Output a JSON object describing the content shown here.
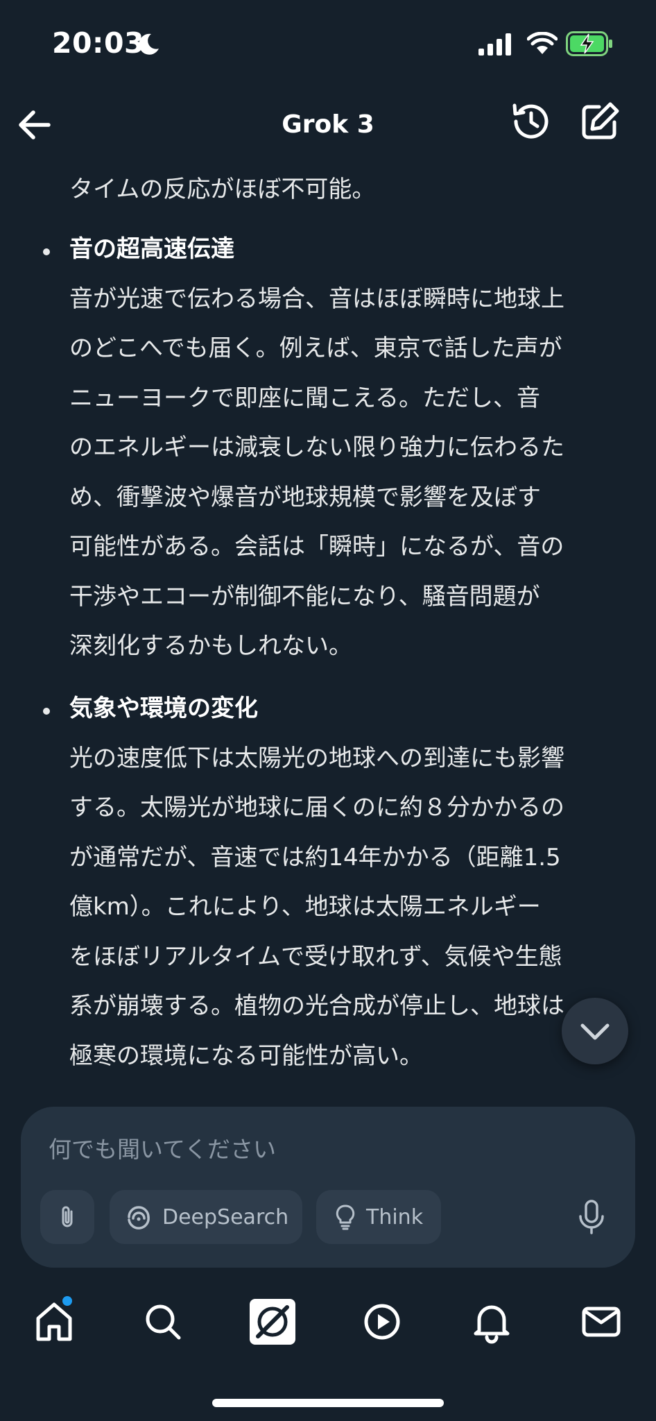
{
  "status": {
    "time": "20:03"
  },
  "header": {
    "title": "Grok 3"
  },
  "chat": {
    "intro_line": "タイムの反応がほぼ不可能。",
    "sections": [
      {
        "heading": "音の超高速伝達",
        "lines": [
          "音が光速で伝わる場合、音はほぼ瞬時に地球上",
          "のどこへでも届く。例えば、東京で話した声が",
          "ニューヨークで即座に聞こえる。ただし、音",
          "のエネルギーは減衰しない限り強力に伝わるた",
          "め、衝撃波や爆音が地球規模で影響を及ぼす",
          "可能性がある。会話は「瞬時」になるが、音の",
          "干渉やエコーが制御不能になり、騒音問題が",
          "深刻化するかもしれない。"
        ]
      },
      {
        "heading": "気象や環境の変化",
        "lines": [
          "光の速度低下は太陽光の地球への到達にも影響",
          "する。太陽光が地球に届くのに約８分かかるの",
          "が通常だが、音速では約14年かかる（距離1.5",
          "億km）。これにより、地球は太陽エネルギー",
          "をほぼリアルタイムで受け取れず、気候や生態",
          "系が崩壊する。植物の光合成が停止し、地球は",
          "極寒の環境になる可能性が高い。"
        ]
      }
    ]
  },
  "composer": {
    "placeholder": "何でも聞いてください",
    "deepsearch_label": "DeepSearch",
    "think_label": "Think"
  },
  "tabbar": {
    "items": [
      "home-icon",
      "search-icon",
      "grok-icon",
      "play-icon",
      "bell-icon",
      "mail-icon"
    ]
  },
  "colors": {
    "background": "#15202b",
    "composer": "#253341",
    "accent": "#1d9bf0"
  }
}
